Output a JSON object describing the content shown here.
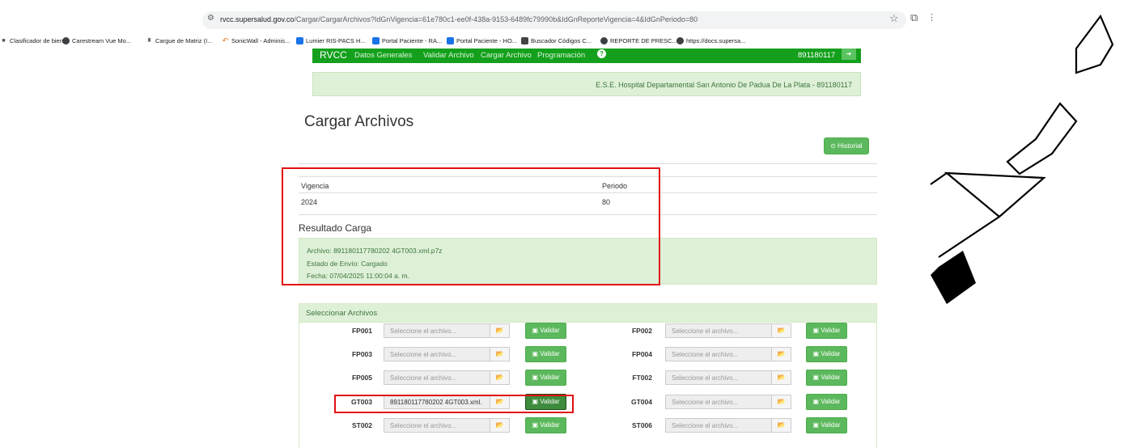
{
  "browser": {
    "url_host": "rvcc.supersalud.gov.co",
    "url_path": "/Cargar/CargarArchivos?IdGnVigencia=61e780c1-ee0f-438a-9153-6489fc79990b&IdGnReporteVigencia=4&IdGnPeriodo=80",
    "bookmarks": [
      "Clasificador de bien...",
      "Carestream Vue Mo...",
      "Cargue de Matriz (I...",
      "SonicWall - Adminis...",
      "Lumier RIS-PACS H...",
      "Portal Paciente - RA...",
      "Portal Paciente - HO...",
      "Buscador Códigos C...",
      "REPORTE DE PRESC...",
      "https://docs.supersa..."
    ]
  },
  "navbar": {
    "brand": "RVCC",
    "items": [
      "Datos Generales",
      "Validar Archivo",
      "Cargar Archivo",
      "Programación"
    ],
    "help": "?",
    "user_id": "891180117"
  },
  "entity": "E.S.E. Hospital Departamental San Antonio De Padua De La Plata - 891180117",
  "page_title": "Cargar Archivos",
  "history_button": "Historial",
  "table": {
    "headers": [
      "Vigencia",
      "Periodo"
    ],
    "values": [
      "2024",
      "80"
    ]
  },
  "result": {
    "title": "Resultado Carga",
    "file": "Archivo: 891180117780202 4GT003.xml.p7z",
    "status": "Estado de Envío: Cargado",
    "date": "Fecha: 07/04/2025 11:00:04 a. m."
  },
  "files_panel": {
    "title": "Seleccionar Archivos",
    "validate_label": "Validar",
    "placeholder": "Seleccione el archivo...",
    "rows": [
      {
        "left_code": "FP001",
        "left_value": "Seleccione el archivo...",
        "right_code": "FP002",
        "right_value": "Seleccione el archivo..."
      },
      {
        "left_code": "FP003",
        "left_value": "Seleccione el archivo...",
        "right_code": "FP004",
        "right_value": "Seleccione el archivo..."
      },
      {
        "left_code": "FP005",
        "left_value": "Seleccione el archivo...",
        "right_code": "FT002",
        "right_value": "Seleccione el archivo..."
      },
      {
        "left_code": "GT003",
        "left_value": "891180117780202 4GT003.xml.",
        "right_code": "GT004",
        "right_value": "Seleccione el archivo..."
      },
      {
        "left_code": "ST002",
        "left_value": "Seleccione el archivo...",
        "right_code": "ST006",
        "right_value": "Seleccione el archivo..."
      }
    ]
  },
  "colors": {
    "nav_green": "#14a01c",
    "btn_green": "#5cb85c",
    "success_bg": "#dff0d8",
    "success_text": "#3c763d",
    "highlight_red": "#e01010"
  }
}
